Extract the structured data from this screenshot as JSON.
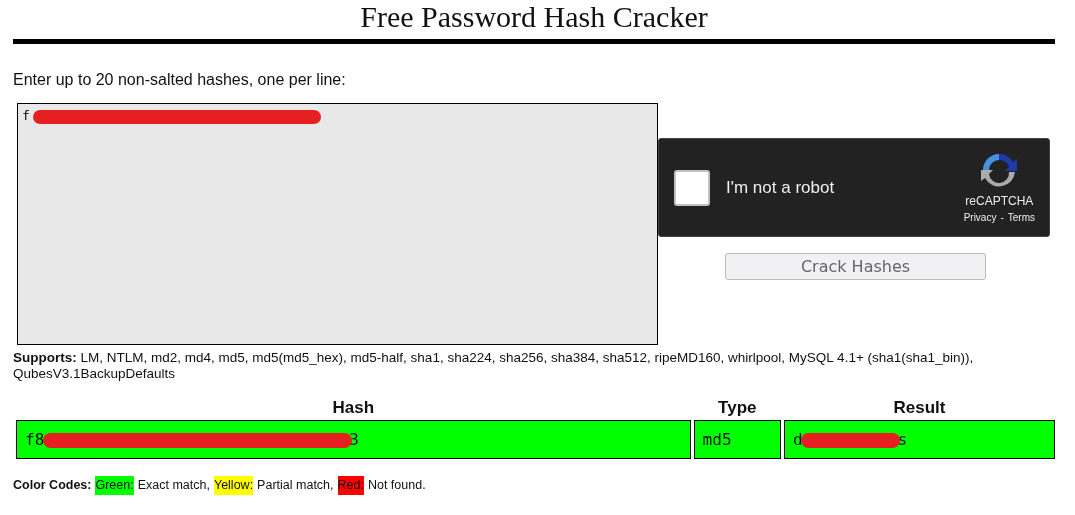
{
  "title": "Free Password Hash Cracker",
  "prompt": "Enter up to 20 non-salted hashes, one per line:",
  "hashes_input": {
    "value": "f",
    "redacted": true
  },
  "captcha": {
    "label": "I'm not a robot",
    "checked": false,
    "brand": "reCAPTCHA",
    "privacy": "Privacy",
    "separator": "-",
    "terms": "Terms"
  },
  "submit_button": {
    "label": "Crack Hashes",
    "disabled": true
  },
  "supports": {
    "label": "Supports:",
    "text": "LM, NTLM, md2, md4, md5, md5(md5_hex), md5-half, sha1, sha224, sha256, sha384, sha512, ripeMD160, whirlpool, MySQL 4.1+ (sha1(sha1_bin)), QubesV3.1BackupDefaults"
  },
  "results": {
    "columns": [
      "Hash",
      "Type",
      "Result"
    ],
    "rows": [
      {
        "color": "#00ff00",
        "hash_start": "f8",
        "hash_end": "3",
        "type": "md5",
        "result_start": "d",
        "result_end": "s"
      }
    ]
  },
  "color_codes": {
    "label": "Color Codes:",
    "items": [
      {
        "name": "Green:",
        "color": "#00ff00",
        "meaning": "Exact match,"
      },
      {
        "name": "Yellow:",
        "color": "#ffff00",
        "meaning": "Partial match,"
      },
      {
        "name": "Red:",
        "color": "#ff0000",
        "meaning": "Not found."
      }
    ]
  }
}
